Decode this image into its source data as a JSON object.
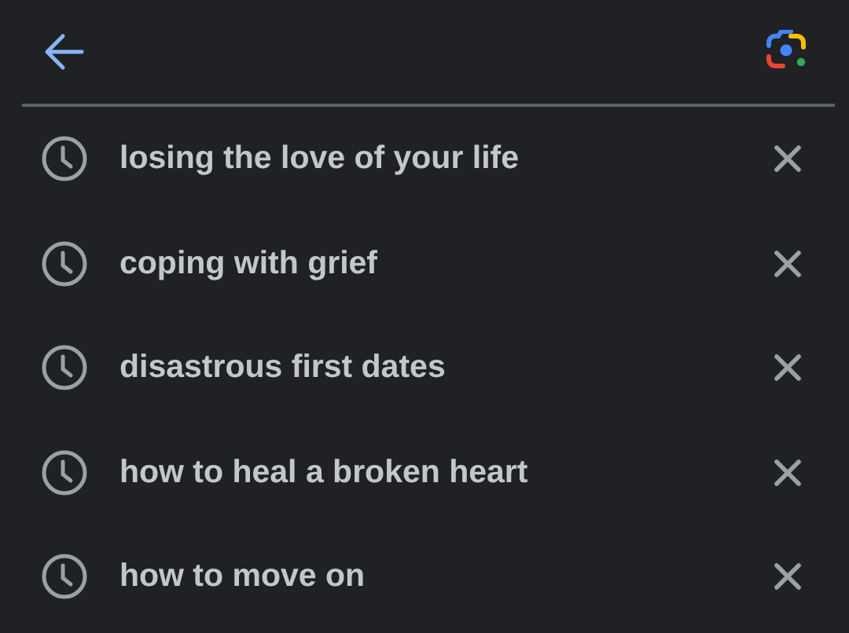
{
  "history": [
    {
      "query": "losing the love of your life"
    },
    {
      "query": "coping with grief"
    },
    {
      "query": "disastrous first dates"
    },
    {
      "query": "how to heal a broken heart"
    },
    {
      "query": "how to move on"
    }
  ]
}
